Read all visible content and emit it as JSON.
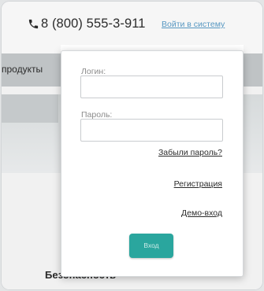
{
  "header": {
    "phone_icon": "phone-icon",
    "phone": "8 (800) 555-3-911",
    "login_link": "Войти в систему"
  },
  "nav": {
    "item_label": "продукты"
  },
  "login_form": {
    "login_label": "Логин:",
    "password_label": "Пароль:",
    "forgot_link": "Забыли пароль?",
    "register_link": "Регистрация",
    "demo_link": "Демо-вход",
    "submit_label": "Вход"
  },
  "content": {
    "bottom_title": "Безопасность"
  },
  "colors": {
    "accent": "#2aa69e",
    "link": "#3a86b8"
  }
}
